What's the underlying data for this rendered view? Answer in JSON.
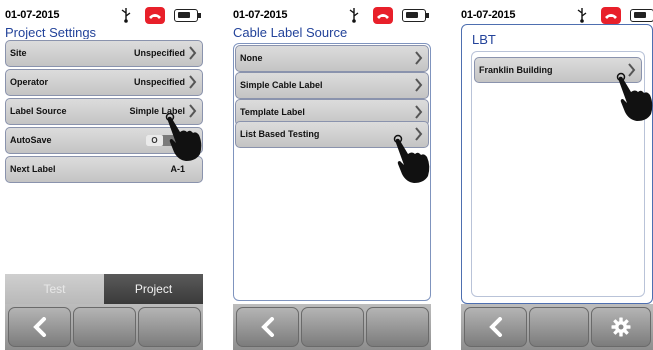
{
  "screens": [
    {
      "status": {
        "date": "01-07-2015"
      },
      "title": "Project Settings",
      "rows": [
        {
          "label": "Site",
          "value": "Unspecified"
        },
        {
          "label": "Operator",
          "value": "Unspecified"
        },
        {
          "label": "Label Source",
          "value": "Simple Label"
        },
        {
          "label": "AutoSave",
          "toggle": "O"
        },
        {
          "label": "Next Label",
          "value": "A-1"
        }
      ],
      "tabs": {
        "test": "Test",
        "project": "Project"
      }
    },
    {
      "status": {
        "date": "01-07-2015"
      },
      "title": "Cable Label Source",
      "rows": [
        {
          "label": "None"
        },
        {
          "label": "Simple Cable Label"
        },
        {
          "label": "Template Label"
        },
        {
          "label": "List Based Testing"
        }
      ]
    },
    {
      "status": {
        "date": "01-07-2015"
      },
      "title": "LBT",
      "rows": [
        {
          "label": "Franklin Building"
        }
      ]
    }
  ],
  "icons": [
    "usb-icon",
    "phone-hangup-icon",
    "battery-icon",
    "chevron-right-icon",
    "back-arrow-icon",
    "gear-icon",
    "pointing-hand-icon"
  ],
  "colors": {
    "title": "#23439a",
    "phone": "#e8202a",
    "panel_border": "#7f94be"
  }
}
